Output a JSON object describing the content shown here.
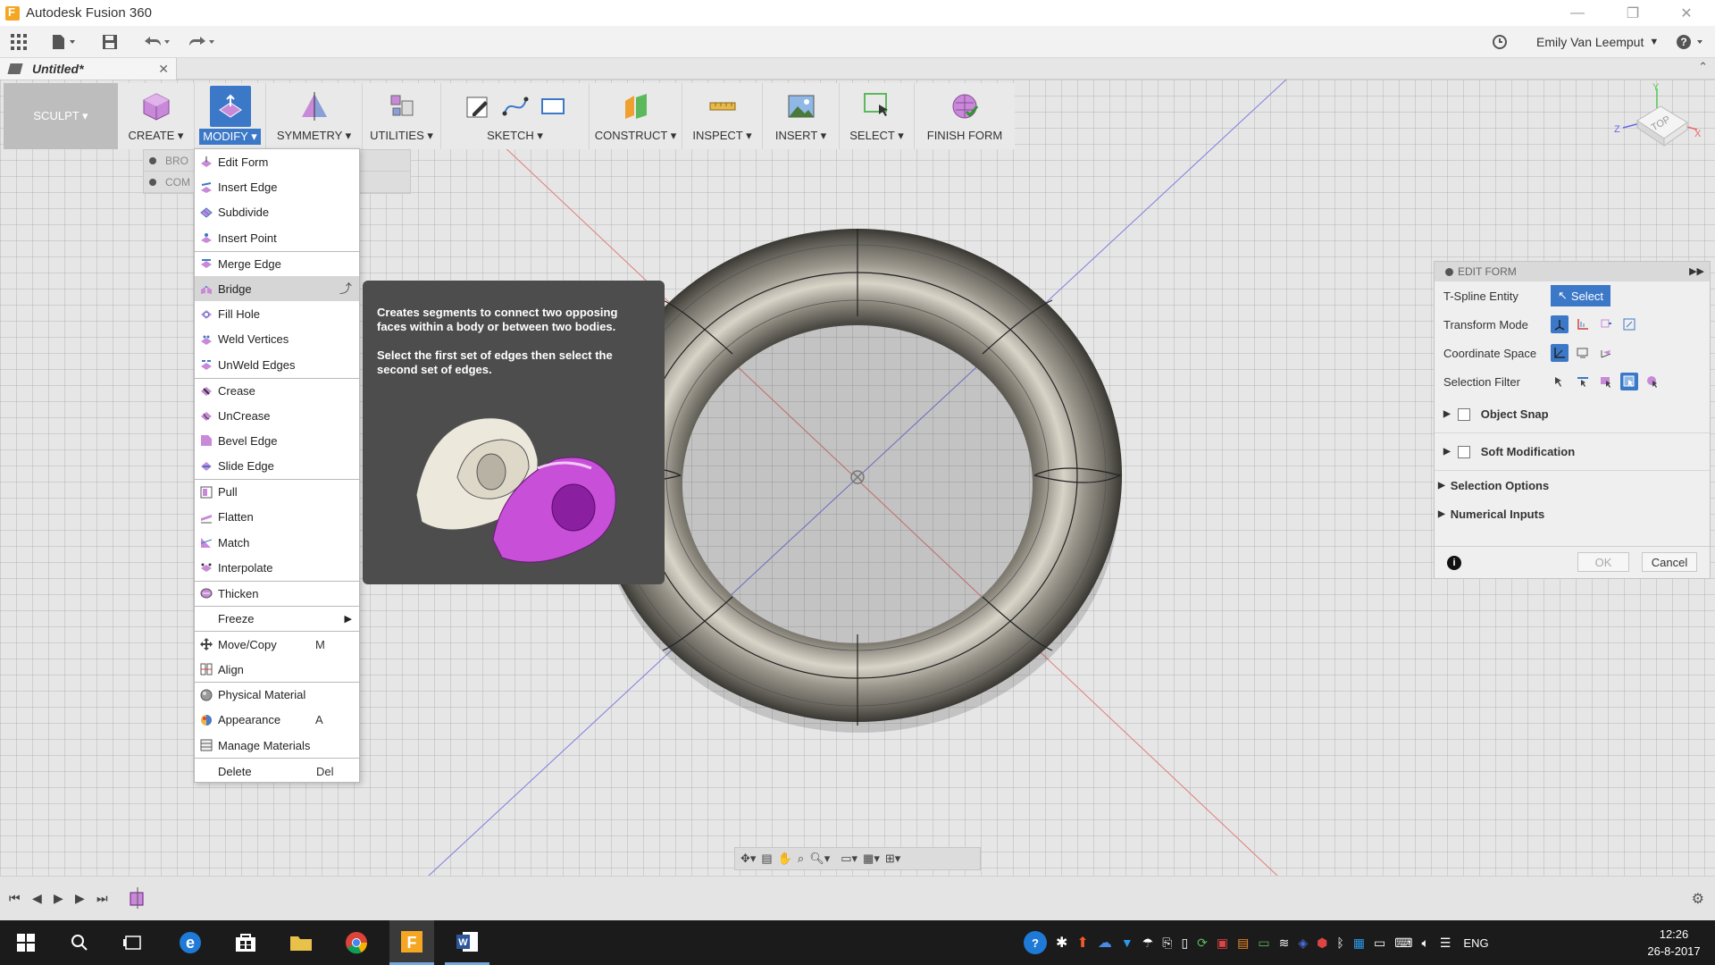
{
  "window": {
    "title": "Autodesk Fusion 360",
    "controls": [
      "minimize",
      "restore",
      "close"
    ]
  },
  "quick_access": {
    "user": "Emily Van Leemput",
    "icons": [
      "grid-icon",
      "file-icon",
      "save-icon",
      "undo-icon",
      "redo-icon",
      "history-icon",
      "help-icon"
    ]
  },
  "tab": {
    "name": "Untitled*"
  },
  "ribbon": {
    "workspace": "SCULPT ▾",
    "groups": [
      {
        "label": "CREATE ▾"
      },
      {
        "label": "MODIFY ▾"
      },
      {
        "label": "SYMMETRY ▾"
      },
      {
        "label": "UTILITIES ▾"
      },
      {
        "label": "SKETCH ▾"
      },
      {
        "label": "CONSTRUCT ▾"
      },
      {
        "label": "INSPECT ▾"
      },
      {
        "label": "INSERT ▾"
      },
      {
        "label": "SELECT ▾"
      },
      {
        "label": "FINISH FORM"
      }
    ]
  },
  "browser": {
    "rows": [
      "BRO",
      "COM"
    ]
  },
  "modify_menu": {
    "items": [
      {
        "label": "Edit Form"
      },
      {
        "label": "Insert Edge"
      },
      {
        "label": "Subdivide"
      },
      {
        "label": "Insert Point"
      },
      {
        "label": "Merge Edge"
      },
      {
        "label": "Bridge"
      },
      {
        "label": "Fill Hole"
      },
      {
        "label": "Weld Vertices"
      },
      {
        "label": "UnWeld Edges"
      },
      {
        "label": "Crease"
      },
      {
        "label": "UnCrease"
      },
      {
        "label": "Bevel Edge"
      },
      {
        "label": "Slide Edge"
      },
      {
        "label": "Pull"
      },
      {
        "label": "Flatten"
      },
      {
        "label": "Match"
      },
      {
        "label": "Interpolate"
      },
      {
        "label": "Thicken"
      },
      {
        "label": "Freeze"
      },
      {
        "label": "Move/Copy",
        "shortcut": "M"
      },
      {
        "label": "Align"
      },
      {
        "label": "Physical Material"
      },
      {
        "label": "Appearance",
        "shortcut": "A"
      },
      {
        "label": "Manage Materials"
      },
      {
        "label": "Delete",
        "shortcut": "Del"
      }
    ]
  },
  "tooltip": {
    "line1": "Creates segments to connect two opposing faces within a body or between two bodies.",
    "line2": "Select the first set of edges then select the second set of edges."
  },
  "edit_form": {
    "title": "EDIT FORM",
    "tspline_label": "T-Spline Entity",
    "select_label": "Select",
    "transform_label": "Transform Mode",
    "coord_label": "Coordinate Space",
    "filter_label": "Selection Filter",
    "object_snap": "Object Snap",
    "soft_mod": "Soft Modification",
    "selection_options": "Selection Options",
    "numerical_inputs": "Numerical Inputs",
    "ok": "OK",
    "cancel": "Cancel"
  },
  "viewcube": {
    "face": "TOP",
    "axes": [
      "Y",
      "Z",
      "X"
    ]
  },
  "taskbar": {
    "lang": "ENG",
    "time": "12:26",
    "date": "26-8-2017"
  },
  "colors": {
    "accent": "#3c78c8",
    "menu_hover": "#d6d6d6",
    "tooltip_bg": "#4d4d4d",
    "sculpt_pink": "#c84fd8"
  }
}
